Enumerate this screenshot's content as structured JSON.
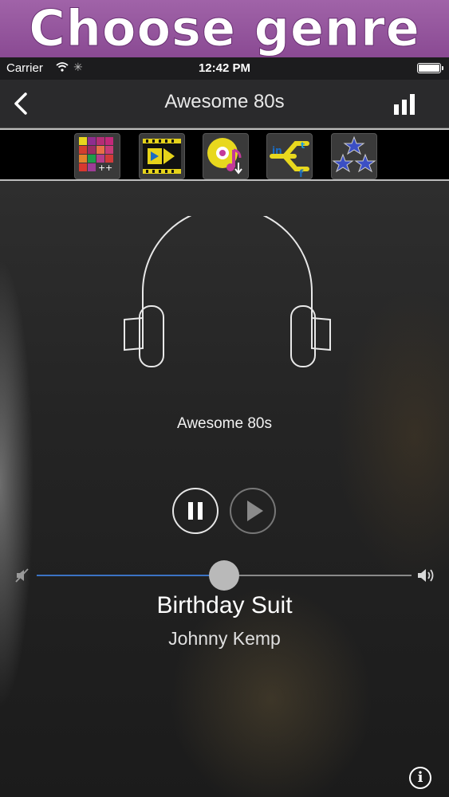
{
  "banner": {
    "text": "Choose genre"
  },
  "status_bar": {
    "carrier": "Carrier",
    "time": "12:42 PM"
  },
  "navbar": {
    "title": "Awesome 80s"
  },
  "app_strip": [
    {
      "icon": "color-grid-app-icon"
    },
    {
      "icon": "video-film-app-icon"
    },
    {
      "icon": "music-download-app-icon"
    },
    {
      "icon": "social-share-app-icon"
    },
    {
      "icon": "stars-app-icon"
    }
  ],
  "player": {
    "station": "Awesome 80s",
    "song_title": "Birthday Suit",
    "artist": "Johnny Kemp",
    "volume": 0.5
  },
  "colors": {
    "banner": "#8a4a93",
    "accent": "#3b73c4"
  }
}
